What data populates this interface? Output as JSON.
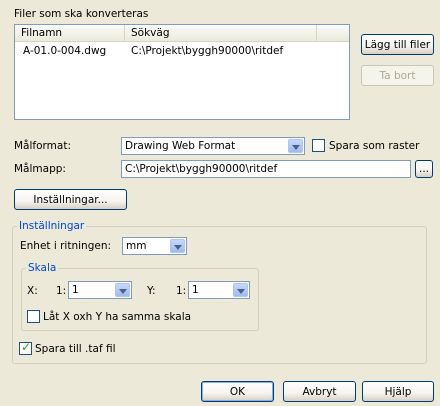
{
  "files": {
    "section_label": "Filer som ska konverteras",
    "columns": [
      "Filnamn",
      "Sökväg"
    ],
    "rows": [
      {
        "name": "A-01.0-004.dwg",
        "path": "C:\\Projekt\\byggh90000\\ritdef"
      }
    ],
    "add_button": "Lägg till filer",
    "remove_button": "Ta bort"
  },
  "target": {
    "format_label": "Målformat:",
    "format_value": "Drawing Web Format",
    "save_raster_label": "Spara som raster",
    "save_raster_checked": false,
    "folder_label": "Målmapp:",
    "folder_value": "C:\\Projekt\\byggh90000\\ritdef",
    "browse_button": "...",
    "settings_button": "Inställningar..."
  },
  "settings": {
    "group_title": "Inställningar",
    "unit_label": "Enhet i ritningen:",
    "unit_value": "mm",
    "scale": {
      "group_title": "Skala",
      "x_label": "X:",
      "x_prefix": "1:",
      "x_value": "1",
      "y_label": "Y:",
      "y_prefix": "1:",
      "y_value": "1",
      "lock_label": "Låt X oxh Y ha samma skala",
      "lock_checked": false
    },
    "save_taf_label": "Spara till .taf fil",
    "save_taf_checked": true
  },
  "footer": {
    "ok": "OK",
    "cancel": "Avbryt",
    "help": "Hjälp"
  },
  "colors": {
    "dialog_bg": "#ece9d8",
    "group_title": "#0046d5",
    "button_border": "#003c74",
    "field_border": "#7f9db9"
  }
}
